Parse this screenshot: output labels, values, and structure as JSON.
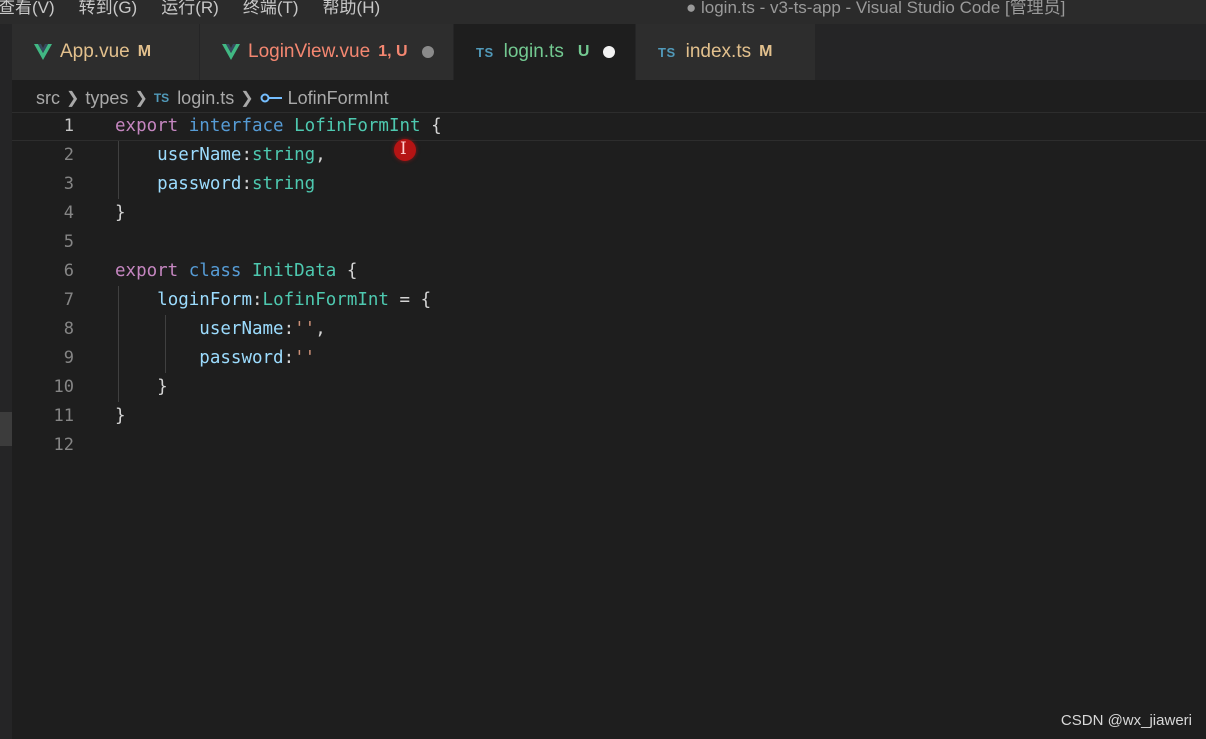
{
  "menubar": {
    "items": [
      "查看(V)",
      "转到(G)",
      "运行(R)",
      "终端(T)",
      "帮助(H)"
    ],
    "window_title": "● login.ts - v3-ts-app - Visual Studio Code [管理员]"
  },
  "tabs": [
    {
      "label": "App.vue",
      "icon": "vue-icon",
      "badge": "M",
      "color": "#e2c08d",
      "active": false
    },
    {
      "label": "LoginView.vue",
      "icon": "vue-icon",
      "badge": "1, U",
      "color": "#f48771",
      "active": false,
      "dirty": true
    },
    {
      "label": "login.ts",
      "icon": "ts-icon",
      "badge": "U",
      "color": "#73c991",
      "active": true,
      "dirty": true
    },
    {
      "label": "index.ts",
      "icon": "ts-icon",
      "badge": "M",
      "color": "#e2c08d",
      "active": false
    }
  ],
  "ts_icon_text": "TS",
  "breadcrumb": {
    "parts": [
      "src",
      "types",
      "login.ts",
      "LofinFormInt"
    ]
  },
  "editor": {
    "line_numbers": [
      "1",
      "2",
      "3",
      "4",
      "5",
      "6",
      "7",
      "8",
      "9",
      "10",
      "11",
      "12"
    ],
    "current_line": 1,
    "lines": [
      [
        [
          "kw",
          "export"
        ],
        [
          "punc",
          " "
        ],
        [
          "kw2",
          "interface"
        ],
        [
          "punc",
          " "
        ],
        [
          "type",
          "LofinFormInt"
        ],
        [
          "punc",
          " {"
        ]
      ],
      [
        [
          "punc",
          "    "
        ],
        [
          "prop",
          "userName"
        ],
        [
          "punc",
          ":"
        ],
        [
          "type",
          "string"
        ],
        [
          "punc",
          ","
        ]
      ],
      [
        [
          "punc",
          "    "
        ],
        [
          "prop",
          "password"
        ],
        [
          "punc",
          ":"
        ],
        [
          "type",
          "string"
        ]
      ],
      [
        [
          "punc",
          "}"
        ]
      ],
      [],
      [
        [
          "kw",
          "export"
        ],
        [
          "punc",
          " "
        ],
        [
          "kw2",
          "class"
        ],
        [
          "punc",
          " "
        ],
        [
          "type",
          "InitData"
        ],
        [
          "punc",
          " {"
        ]
      ],
      [
        [
          "punc",
          "    "
        ],
        [
          "prop",
          "loginForm"
        ],
        [
          "punc",
          ":"
        ],
        [
          "type",
          "LofinFormInt"
        ],
        [
          "punc",
          " = {"
        ]
      ],
      [
        [
          "punc",
          "        "
        ],
        [
          "prop",
          "userName"
        ],
        [
          "punc",
          ":"
        ],
        [
          "str",
          "''"
        ],
        [
          "punc",
          ","
        ]
      ],
      [
        [
          "punc",
          "        "
        ],
        [
          "prop",
          "password"
        ],
        [
          "punc",
          ":"
        ],
        [
          "str",
          "''"
        ]
      ],
      [
        [
          "punc",
          "    }"
        ]
      ],
      [
        [
          "punc",
          "}"
        ]
      ],
      []
    ]
  },
  "watermark": "CSDN @wx_jiaweri",
  "colors": {
    "background": "#1e1e1e",
    "keyword": "#c586c0",
    "keyword_blue": "#569cd6",
    "type": "#4ec9b0",
    "property": "#9cdcfe",
    "string": "#ce9178",
    "vue_green": "#41b883"
  }
}
